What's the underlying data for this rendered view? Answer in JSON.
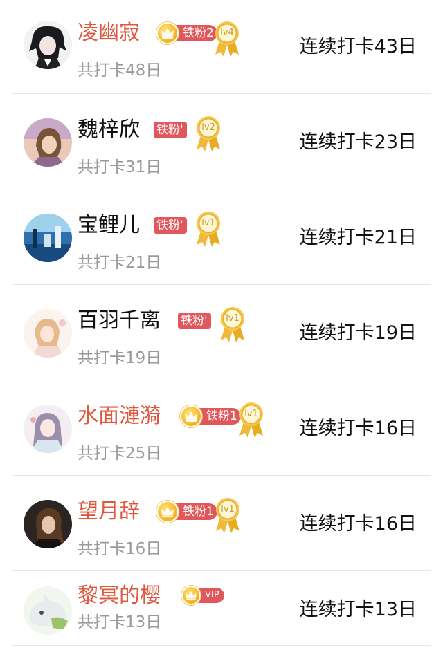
{
  "colors": {
    "member_name": "#e0573e",
    "normal_name": "#111111",
    "badge": "#e0585c",
    "medal_gold": "#f1bd3a",
    "subtext": "#9a9a9a"
  },
  "rows": [
    {
      "name": "凌幽寂",
      "fan_badge": "铁粉2",
      "level": "lv4",
      "total": "共打卡48日",
      "streak": "连续打卡43日"
    },
    {
      "name": "魏梓欣",
      "fan_badge": "铁粉'",
      "level": "lv2",
      "total": "共打卡31日",
      "streak": "连续打卡23日"
    },
    {
      "name": "宝鲤儿",
      "fan_badge": "铁粉'",
      "level": "lv1",
      "total": "共打卡21日",
      "streak": "连续打卡21日"
    },
    {
      "name": "百羽千离",
      "fan_badge": "铁粉'",
      "level": "lv1",
      "total": "共打卡19日",
      "streak": "连续打卡19日"
    },
    {
      "name": "水面漣漪",
      "fan_badge": "铁粉1",
      "level": "lv1",
      "total": "共打卡25日",
      "streak": "连续打卡16日"
    },
    {
      "name": "望月辞",
      "fan_badge": "铁粉1",
      "level": "lv1",
      "total": "共打卡16日",
      "streak": "连续打卡16日"
    },
    {
      "name": "黎冥的樱",
      "vip_badge": "VIP",
      "total": "共打卡13日",
      "streak": "连续打卡13日"
    }
  ]
}
